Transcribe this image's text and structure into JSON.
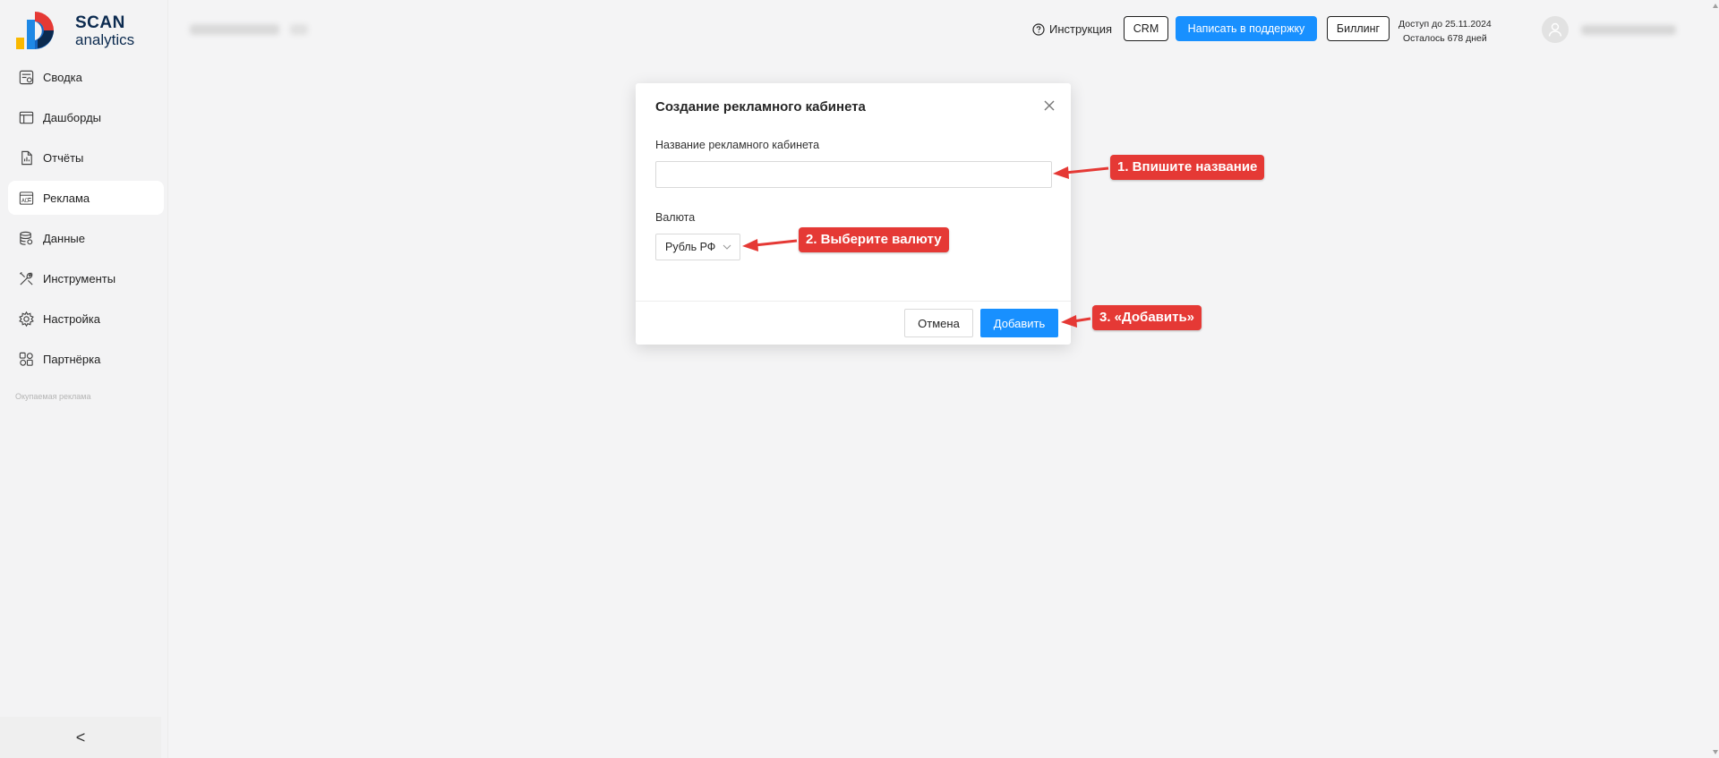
{
  "brand": {
    "line1": "SCAN",
    "line2": "analytics",
    "colors": {
      "navy": "#0b2a4f",
      "blue": "#1e88e5",
      "red": "#e53935",
      "yellow": "#f9b800"
    }
  },
  "sidebar": {
    "items": [
      {
        "label": "Сводка",
        "icon": "summary-icon"
      },
      {
        "label": "Дашборды",
        "icon": "dashboard-icon"
      },
      {
        "label": "Отчёты",
        "icon": "report-icon"
      },
      {
        "label": "Реклама",
        "icon": "ad-icon",
        "active": true
      },
      {
        "label": "Данные",
        "icon": "database-icon"
      },
      {
        "label": "Инструменты",
        "icon": "tools-icon"
      },
      {
        "label": "Настройка",
        "icon": "gear-icon"
      },
      {
        "label": "Партнёрка",
        "icon": "partner-icon"
      }
    ],
    "section_label": "Окупаемая реклама",
    "collapse_glyph": "<"
  },
  "header": {
    "help_label": "Инструкция",
    "crm_label": "CRM",
    "support_label": "Написать в поддержку",
    "billing_label": "Биллинг",
    "access_line1": "Доступ до 25.11.2024",
    "access_line2": "Осталось 678 дней"
  },
  "modal": {
    "title": "Создание рекламного кабинета",
    "name_label": "Название рекламного кабинета",
    "name_value": "",
    "name_placeholder": "",
    "currency_label": "Валюта",
    "currency_value": "Рубль РФ",
    "cancel_label": "Отмена",
    "add_label": "Добавить"
  },
  "annotations": {
    "step1": "1. Впишите название",
    "step2": "2. Выберите валюту",
    "step3": "3. «Добавить»",
    "color": "#e53935"
  },
  "accent": "#1890ff"
}
